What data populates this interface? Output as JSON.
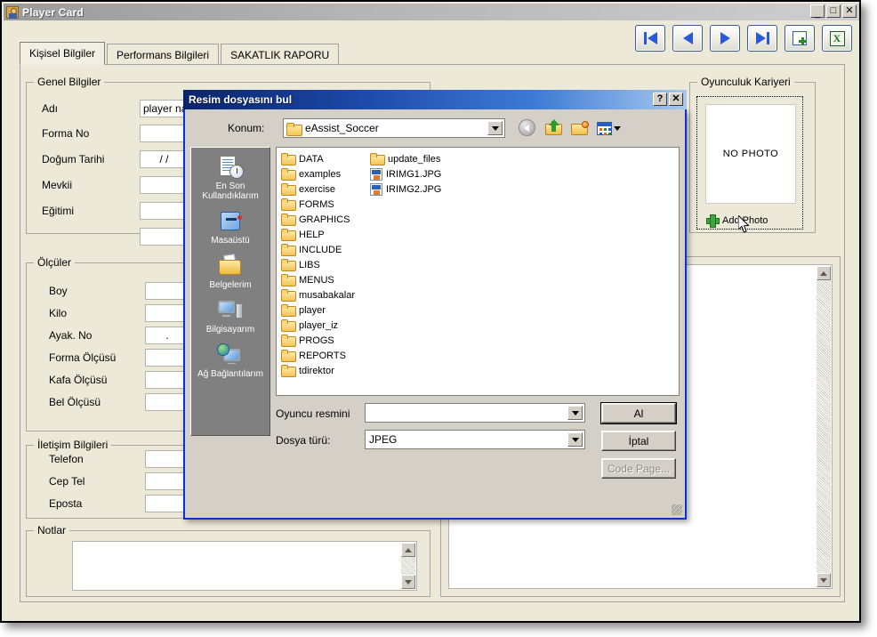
{
  "window": {
    "title": "Player Card",
    "icon": "user-icon",
    "minimize_label": "_",
    "maximize_label": "□",
    "close_label": "✕"
  },
  "toolbar": {
    "buttons": [
      {
        "name": "first-record-button",
        "icon": "first-record-icon",
        "label": ""
      },
      {
        "name": "previous-record-button",
        "icon": "previous-record-icon",
        "label": ""
      },
      {
        "name": "next-record-button",
        "icon": "next-record-icon",
        "label": ""
      },
      {
        "name": "last-record-button",
        "icon": "last-record-icon",
        "label": ""
      },
      {
        "name": "add-record-button",
        "icon": "add-plus-icon",
        "label": ""
      },
      {
        "name": "export-excel-button",
        "icon": "excel-icon",
        "label": "X"
      }
    ]
  },
  "tabs": [
    {
      "label": "Kişisel Bilgiler",
      "active": true
    },
    {
      "label": "Performans Bilgileri",
      "active": false
    },
    {
      "label": "SAKATLIK RAPORU",
      "active": false
    }
  ],
  "groups": {
    "general": {
      "title": "Genel Bilgiler",
      "fields": [
        {
          "label": "Adı",
          "value": "player name"
        },
        {
          "label": "Forma No",
          "value": ""
        },
        {
          "label": "Doğum Tarihi",
          "value": "  /  /"
        },
        {
          "label": "Mevkii",
          "value": ""
        },
        {
          "label": "Eğitimi",
          "value": ""
        },
        {
          "label": "",
          "value": ""
        }
      ]
    },
    "measurements": {
      "title": "Ölçüler",
      "fields": [
        {
          "label": "Boy",
          "value": ""
        },
        {
          "label": "Kilo",
          "value": ""
        },
        {
          "label": "Ayak. No",
          "value": "."
        },
        {
          "label": "Forma Ölçüsü",
          "value": ""
        },
        {
          "label": "Kafa Ölçüsü",
          "value": ""
        },
        {
          "label": "Bel Ölçüsü",
          "value": ""
        }
      ]
    },
    "contact": {
      "title": "İletişim Bilgileri",
      "fields": [
        {
          "label": "Telefon",
          "value": ""
        },
        {
          "label": "Cep Tel",
          "value": ""
        },
        {
          "label": "Eposta",
          "value": ""
        }
      ]
    },
    "notes": {
      "title": "Notlar",
      "value": ""
    },
    "career": {
      "title": "Oyunculuk Kariyeri",
      "photo_placeholder": "NO PHOTO",
      "add_photo_label": "Add Photo"
    }
  },
  "file_dialog": {
    "title": "Resim dosyasını bul",
    "help_label": "?",
    "close_label": "✕",
    "location_label": "Konum:",
    "location_value": "eAssist_Soccer",
    "toolbar_icons": [
      {
        "name": "back-icon",
        "enabled": false
      },
      {
        "name": "up-one-level-icon",
        "enabled": true
      },
      {
        "name": "new-folder-icon",
        "enabled": true
      },
      {
        "name": "views-icon",
        "enabled": true
      }
    ],
    "places": [
      {
        "name": "recent-documents",
        "label": "En Son\nKullandıklarım",
        "icon": "recent-documents-icon"
      },
      {
        "name": "desktop",
        "label": "Masaüstü",
        "icon": "desktop-icon"
      },
      {
        "name": "my-documents",
        "label": "Belgelerim",
        "icon": "my-documents-icon"
      },
      {
        "name": "my-computer",
        "label": "Bilgisayarım",
        "icon": "my-computer-icon"
      },
      {
        "name": "network-places",
        "label": "Ağ Bağlantılarım",
        "icon": "network-icon"
      }
    ],
    "files": [
      {
        "name": "DATA",
        "type": "folder"
      },
      {
        "name": "examples",
        "type": "folder"
      },
      {
        "name": "exercise",
        "type": "folder"
      },
      {
        "name": "FORMS",
        "type": "folder"
      },
      {
        "name": "GRAPHICS",
        "type": "folder"
      },
      {
        "name": "HELP",
        "type": "folder"
      },
      {
        "name": "INCLUDE",
        "type": "folder"
      },
      {
        "name": "LIBS",
        "type": "folder"
      },
      {
        "name": "MENUS",
        "type": "folder"
      },
      {
        "name": "musabakalar",
        "type": "folder"
      },
      {
        "name": "player",
        "type": "folder"
      },
      {
        "name": "player_iz",
        "type": "folder"
      },
      {
        "name": "PROGS",
        "type": "folder"
      },
      {
        "name": "REPORTS",
        "type": "folder"
      },
      {
        "name": "tdirektor",
        "type": "folder"
      },
      {
        "name": "update_files",
        "type": "folder"
      },
      {
        "name": "IRIMG1.JPG",
        "type": "jpg"
      },
      {
        "name": "IRIMG2.JPG",
        "type": "jpg"
      }
    ],
    "filename_label": "Oyuncu resmini",
    "filename_value": "",
    "filetype_label": "Dosya türü:",
    "filetype_value": "JPEG",
    "buttons": [
      {
        "name": "open-button",
        "label": "Al",
        "state": "default"
      },
      {
        "name": "cancel-button",
        "label": "İptal",
        "state": "normal"
      },
      {
        "name": "code-page-button",
        "label": "Code Page...",
        "state": "disabled"
      }
    ]
  },
  "colors": {
    "window_face": "#ece9d8",
    "dialog_face": "#d4d0c8",
    "dialog_title_start": "#0a246a",
    "dialog_title_end": "#a8c8ee",
    "accent_blue": "#2a5bd7",
    "green": "#3fa63f"
  }
}
